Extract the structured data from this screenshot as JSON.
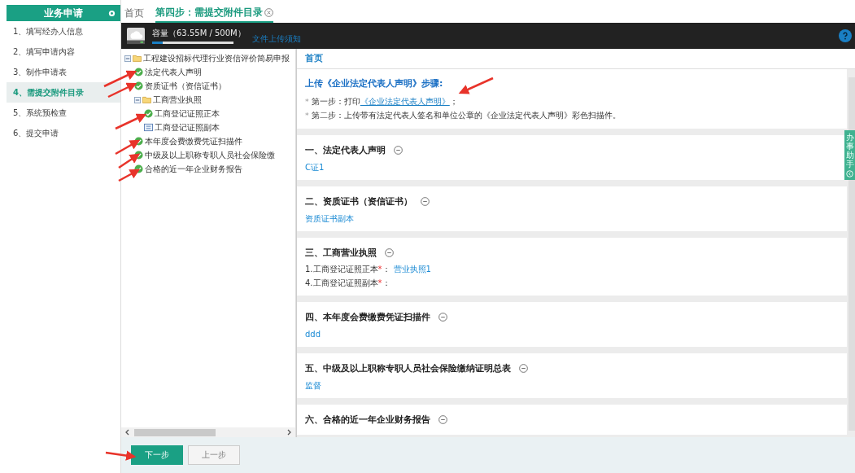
{
  "sidebar": {
    "title": "业务申请",
    "items": [
      {
        "label": "1、填写经办人信息",
        "selected": false
      },
      {
        "label": "2、填写申请内容",
        "selected": false
      },
      {
        "label": "3、制作申请表",
        "selected": false
      },
      {
        "label": "4、需提交附件目录",
        "selected": true
      },
      {
        "label": "5、系统预检查",
        "selected": false
      },
      {
        "label": "6、提交申请",
        "selected": false
      }
    ]
  },
  "tabs": [
    {
      "label": "首页",
      "selected": false,
      "closable": false
    },
    {
      "label": "第四步：需提交附件目录",
      "selected": true,
      "closable": true
    }
  ],
  "storage": {
    "label": "容量（63.55M / 500M）",
    "level": 0.13,
    "link": "文件上传须知"
  },
  "tree": [
    {
      "label": "工程建设招标代理行业资信评价简易申报",
      "kind": "folder",
      "expanded": true,
      "children": [
        {
          "label": "法定代表人声明",
          "kind": "done"
        },
        {
          "label": "资质证书（资信证书）",
          "kind": "done"
        },
        {
          "label": "工商营业执照",
          "kind": "folder",
          "expanded": true,
          "children": [
            {
              "label": "工商登记证照正本",
              "kind": "done"
            },
            {
              "label": "工商登记证照副本",
              "kind": "file"
            }
          ]
        },
        {
          "label": "本年度会费缴费凭证扫描件",
          "kind": "done"
        },
        {
          "label": "中级及以上职称专职人员社会保险缴",
          "kind": "done"
        },
        {
          "label": "合格的近一年企业财务报告",
          "kind": "done"
        }
      ]
    }
  ],
  "content": {
    "breadcrumb": "首页",
    "intro": {
      "title": "上传《企业法定代表人声明》步骤:",
      "steps": [
        {
          "bullet": "*",
          "text": "第一步：打印",
          "link": "《企业法定代表人声明》",
          "after": "；"
        },
        {
          "bullet": "*",
          "text": "第二步：上传带有法定代表人签名和单位公章的《企业法定代表人声明》彩色扫描件。"
        }
      ]
    },
    "sections": [
      {
        "title": "一、法定代表人声明",
        "lines": [
          {
            "kind": "link",
            "text": "C证1"
          }
        ]
      },
      {
        "title": "二、资质证书（资信证书）",
        "lines": [
          {
            "kind": "link",
            "text": "资质证书副本"
          }
        ]
      },
      {
        "title": "三、工商营业执照",
        "lines": [
          {
            "kind": "field",
            "label": "1.工商登记证照正本",
            "mark": "*",
            "suffix": "：",
            "value": "营业执照1"
          },
          {
            "kind": "field",
            "label": "4.工商登记证照副本",
            "mark": "*",
            "suffix": "："
          }
        ]
      },
      {
        "title": "四、本年度会费缴费凭证扫描件",
        "lines": [
          {
            "kind": "link",
            "text": "ddd"
          }
        ]
      },
      {
        "title": "五、中级及以上职称专职人员社会保险缴纳证明总表",
        "lines": [
          {
            "kind": "link",
            "text": "监督"
          }
        ]
      },
      {
        "title": "六、合格的近一年企业财务报告"
      }
    ]
  },
  "side_tab": "办事助手",
  "buttons": [
    {
      "label": "下一步",
      "kind": "primary"
    },
    {
      "label": "上一步",
      "kind": "secondary"
    }
  ]
}
